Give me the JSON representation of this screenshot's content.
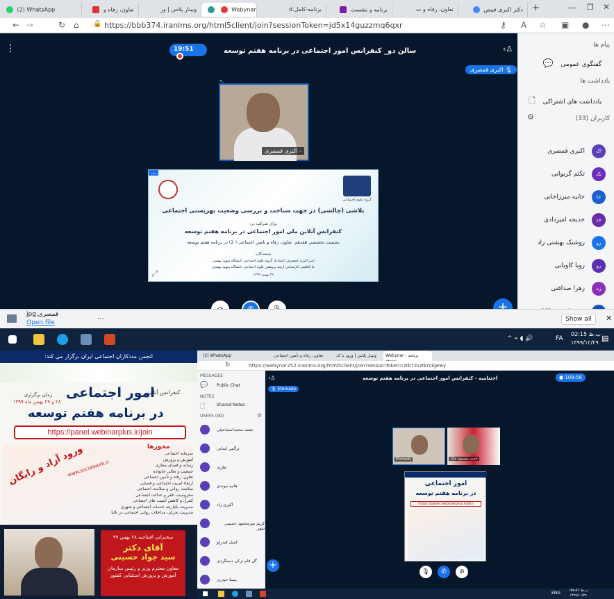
{
  "top_browser": {
    "tabs": [
      {
        "label": "(2) WhatsApp"
      },
      {
        "label": "تعاون، رفاه و"
      },
      {
        "label": "وبینار پلاس | ور"
      },
      {
        "label": "Webynar"
      },
      {
        "label": "برنامه-کامل.d"
      },
      {
        "label": "برنامه و نشست"
      },
      {
        "label": "تعاون، رفاه و ت"
      },
      {
        "label": "دکتر اکبری قمص"
      }
    ],
    "url": "https://bbb374.iranlms.org/html5client/join?sessionToken=jd5x14guzzmq6qxr",
    "meeting": {
      "title": "سالن دو_ کنفرانس امور اجتماعی در برنامه هفتم توسعه",
      "timer": "19:51",
      "talking_badge": "اکبری قمصری",
      "camera_name": "- اکبری قمصری"
    },
    "slide": {
      "heading": "تلاشی (چالشی) در جهت شناخت و بررسی وضعیت بهزیستی اجتماعی",
      "sub1": "برای شرکت در:",
      "conference": "کنفرانس آنلاین ملی امور اجتماعی در برنامه هفتم توسعه",
      "session": "نشست تخصصی هفدهم: تعاون، رفاه و تامین اجتماعی ( 2) در برنامه هفتم توسعه",
      "authors_label": "نویسندگان:",
      "author1": "امیر اکبری قمصری، استادیار گروه علوم اجتماعی دانشگاه شهید بهشتی",
      "author2": "ما کاظمی کارشناس ارشد پژوهش علوم اجتماعی دانشگاه شهید بهشتی",
      "date": "۲۹ بهمن ۱۳۹۹",
      "logo_caption": "گروه علوم اجتماعی"
    },
    "sidebar": {
      "messages_header": "پیام ها",
      "public_chat": "گفتگوی عمومی",
      "notes_header": "یادداشت ها",
      "shared_notes": "یادداشت های اشتراکی",
      "users_header": "کاربران (33)",
      "users": [
        {
          "name": "اکبری قمصری",
          "initials": "اک"
        },
        {
          "name": "تکتم گربوانی",
          "initials": "تک"
        },
        {
          "name": "حانیه میرزاخانی",
          "initials": "حا"
        },
        {
          "name": "خدیجه امیردادی",
          "initials": "خد"
        },
        {
          "name": "روشنک بهشتی زاد",
          "initials": "رو"
        },
        {
          "name": "رویا کاویانی",
          "initials": "رو"
        },
        {
          "name": "زهرا صداقتی",
          "initials": "زه"
        },
        {
          "name": "زینب احمدی لاکانی",
          "initials": "زی"
        }
      ]
    },
    "download": {
      "filename": "قمصری.jpg",
      "open_file": "Open file",
      "show_all": "Show all"
    },
    "taskbar": {
      "lang": "FA",
      "time": "02:15 ب.ظ",
      "date": "۱۳۹۹/۱۲/۲۹"
    }
  },
  "poster": {
    "band": "انجمن مددکاران اجتماعی ایران برگزار می کند:",
    "online": "کنفرانس آنلاین",
    "title1": "امور اجتماعی",
    "title2": "در برنامه هفتم توسعه",
    "dates": "۲۸ و ۲۹ بهمن ماه ۱۳۹۹",
    "time_label": "زمان برگزاری",
    "link": "https://panel.webinarplus.ir/join",
    "free": "ورود آزاد و رایگان",
    "site": "www.socialwork.ir",
    "topics_header": "محورها",
    "topics": [
      "سرمایه اجتماعی",
      "آموزش و پرورش",
      "رسانه و فضای مجازی",
      "جمعیت و تعالی خانواده",
      "تعاون، رفاه و تأمین اجتماعی",
      "ارتقاء امنیت اجتماعی و قضایی",
      "سلامت روانی و سلامت اجتماعی",
      "محرومیت، فقر و عدالت اجتماعی",
      "کنترل و کاهش آسیب های اجتماعی",
      "مدیریت یکپارچه خدمات اجتماعی و شهری",
      "مدیریت بحران، مداخلات روانی اجتماعی در بلایا"
    ],
    "speaker_intro": "سخنرانی افتتاحیه ۲۸ بهمن ۹۹",
    "speaker_title": "آقای دکتر",
    "speaker_name": "سید جواد حسینی",
    "speaker_role": "معاون محترم وزیر و رئیس سازمان آموزش و پرورش استثنایی کشور"
  },
  "second_browser": {
    "tabs": [
      "(2) WhatsApp",
      "تعاون، رفاه و تأمین اجتماعی",
      "وبینار پلاس | ورود با کد",
      "Webynar - برنامه توسعه"
    ],
    "url": "https://webynar252.iranlms.org/html5client/join?sessionToken=ztb7zvztkroigewy",
    "meeting_title": "اختتامیه - کنفرانس امور اجتماعی در برنامه هفتم توسعه",
    "timer": "109:56",
    "talking": "Etemady",
    "cam_a": "Etemady",
    "cam_b": "حسن موسوی چلک",
    "messages": "MESSAGES",
    "public_chat": "Public Chat",
    "notes": "NOTES",
    "shared_notes": "Shared Notes",
    "users_header": "USERS (99)",
    "users": [
      "نجمه محمداسماعیلی",
      "نرگس ایمانی",
      "نظری",
      "هانیه نیوندی",
      "اکبری راد",
      "کریم میرمحمود حسینی شهر",
      "کمیل قیدرلو",
      "گل فام ترکی دستگردی",
      "یسنا حیدری"
    ],
    "taskbar_time": "04:47 ب.ظ",
    "taskbar_date": "۱۳۹۹/۱۱/۲۹",
    "lang": "ENG"
  }
}
